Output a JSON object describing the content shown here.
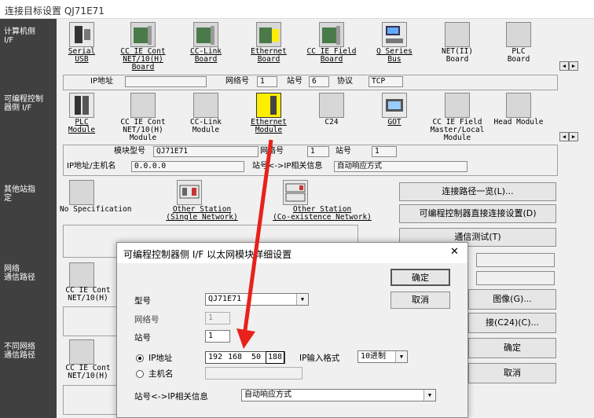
{
  "window": {
    "title": "连接目标设置 QJ71E71"
  },
  "sidebar": {
    "pc_side": "计算机侧\nI/F",
    "plc_side": "可编程控制\n器侧 I/F",
    "other_station": "其他站指\n定",
    "network_route": "网络\n通信路径",
    "diff_network_route": "不同网络\n通信路径"
  },
  "pc_if": {
    "items": [
      {
        "label": "Serial\nUSB",
        "icon": "serial-usb-icon"
      },
      {
        "label": "CC IE Cont\nNET/10(H)\nBoard",
        "icon": "board-icon"
      },
      {
        "label": "CC-Link\nBoard",
        "icon": "board-icon"
      },
      {
        "label": "Ethernet\nBoard",
        "icon": "ethernet-board-icon"
      },
      {
        "label": "CC IE Field\nBoard",
        "icon": "board-icon"
      },
      {
        "label": "Q Series\nBus",
        "icon": "bus-icon"
      },
      {
        "label": "NET(II)\nBoard",
        "icon": "board-icon"
      },
      {
        "label": "PLC\nBoard",
        "icon": "board-icon"
      }
    ],
    "fields": {
      "ip_label": "IP地址",
      "ip_value": "",
      "net_label": "网络号",
      "net_value": "1",
      "station_label": "站号",
      "station_value": "6",
      "protocol_label": "协议",
      "protocol_value": "TCP"
    }
  },
  "plc_if": {
    "items": [
      {
        "label": "PLC\nModule"
      },
      {
        "label": "CC IE Cont\nNET/10(H)\nModule"
      },
      {
        "label": "CC-Link\nModule"
      },
      {
        "label": "Ethernet\nModule"
      },
      {
        "label": "C24"
      },
      {
        "label": "GOT"
      },
      {
        "label": "CC IE Field\nMaster/Local\nModule"
      },
      {
        "label": "Head Module"
      }
    ],
    "fields": {
      "model_label": "模块型号",
      "model_value": "QJ71E71",
      "net_label": "网络号",
      "net_value": "1",
      "station_label": "站号",
      "station_value": "1",
      "ip_label": "IP地址/主机名",
      "ip_value": "0.0.0.0",
      "relation_label": "站号<->IP相关信息",
      "relation_value": "自动响应方式"
    }
  },
  "other_station": {
    "items": [
      {
        "label": "No Specification"
      },
      {
        "label": "Other Station\n(Single Network)"
      },
      {
        "label": "Other Station\n(Co-existence Network)"
      }
    ]
  },
  "right_buttons": {
    "route_list": "连接路径一览(L)...",
    "direct_connect": "可编程控制器直接连接设置(D)",
    "comm_test": "通信测试(T)",
    "image": "图像(G)...",
    "c24": "接(C24)(C)...",
    "ok": "确定",
    "cancel": "取消"
  },
  "network_items": {
    "route": "CC IE Cont\nNET/10(H)",
    "diff_route": "CC IE Cont\nNET/10(H)"
  },
  "dialog": {
    "title": "可编程控制器侧 I/F 以太网模块详细设置",
    "close": "✕",
    "ok": "确定",
    "cancel": "取消",
    "model_label": "型号",
    "model_value": "QJ71E71",
    "net_label": "网络号",
    "net_value": "1",
    "station_label": "站号",
    "station_value": "1",
    "ip_radio": "IP地址",
    "host_radio": "主机名",
    "ip_octets": [
      "192",
      "168",
      "50",
      "188"
    ],
    "ip_format_label": "IP输入格式",
    "ip_format_value": "10进制",
    "relation_label": "站号<->IP相关信息",
    "relation_value": "自动响应方式"
  },
  "colors": {
    "arrow": "#e8211b",
    "sidebar": "#404040",
    "ethernet_highlight": "#ffee00"
  }
}
